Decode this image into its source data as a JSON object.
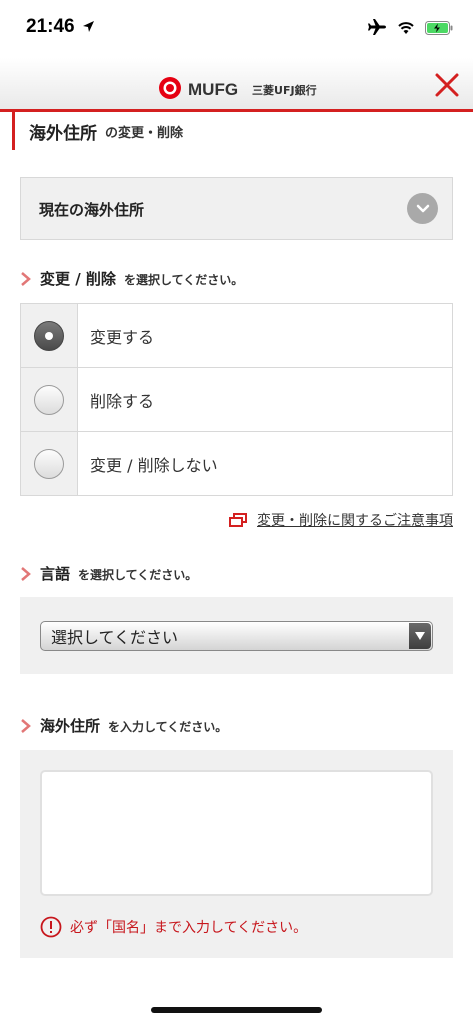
{
  "status_bar": {
    "time": "21:46"
  },
  "header": {
    "brand": "MUFG",
    "bank_name": "三菱UFJ銀行"
  },
  "title": {
    "main": "海外住所",
    "sub": "の変更・削除"
  },
  "accordion": {
    "label": "現在の海外住所"
  },
  "change_section": {
    "strong": "変更 / 削除",
    "weak": "を選択してください。"
  },
  "radio_options": [
    {
      "label": "変更する",
      "checked": true
    },
    {
      "label": "削除する",
      "checked": false
    },
    {
      "label": "変更 / 削除しない",
      "checked": false
    }
  ],
  "notice_link": "変更・削除に関するご注意事項",
  "language_section": {
    "strong": "言語",
    "weak": "を選択してください。"
  },
  "language_select": {
    "value": "選択してください"
  },
  "address_section": {
    "strong": "海外住所",
    "weak": "を入力してください。"
  },
  "address_error": "必ず「国名」まで入力してください。",
  "colors": {
    "accent": "#d42020",
    "error": "#c7161c",
    "panel": "#f0f0f0"
  }
}
